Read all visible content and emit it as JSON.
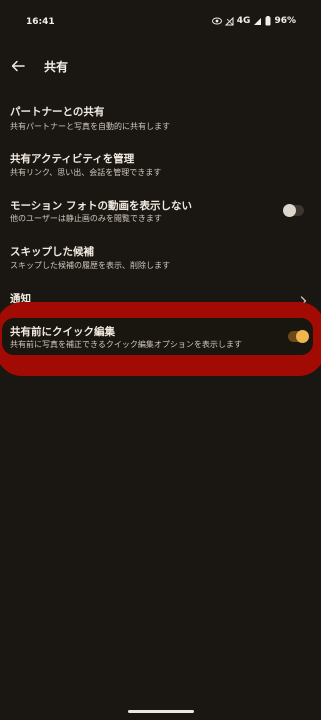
{
  "status_bar": {
    "time": "16:41",
    "network": "4G",
    "battery": "96%",
    "icons": [
      "eye-icon",
      "signal-off-icon",
      "signal-icon",
      "battery-icon"
    ]
  },
  "app_bar": {
    "title": "共有",
    "back_icon": "arrow-left-icon"
  },
  "settings": [
    {
      "title": "パートナーとの共有",
      "subtitle": "共有パートナーと写真を自動的に共有します"
    },
    {
      "title": "共有アクティビティを管理",
      "subtitle": "共有リンク、思い出、会話を管理できます"
    },
    {
      "title": "モーション フォトの動画を表示しない",
      "subtitle": "他のユーザーは静止画のみを閲覧できます",
      "toggle": false
    },
    {
      "title": "スキップした候補",
      "subtitle": "スキップした候補の履歴を表示、削除します"
    },
    {
      "title": "通知",
      "chevron": "chevron-right-icon"
    },
    {
      "title": "共有前にクイック編集",
      "subtitle": "共有前に写真を補正できるクイック編集オプションを表示します",
      "toggle": true
    }
  ],
  "colors": {
    "background": "#1a1713",
    "highlight": "#a20a04",
    "toggle_on": "#f0b54d"
  }
}
